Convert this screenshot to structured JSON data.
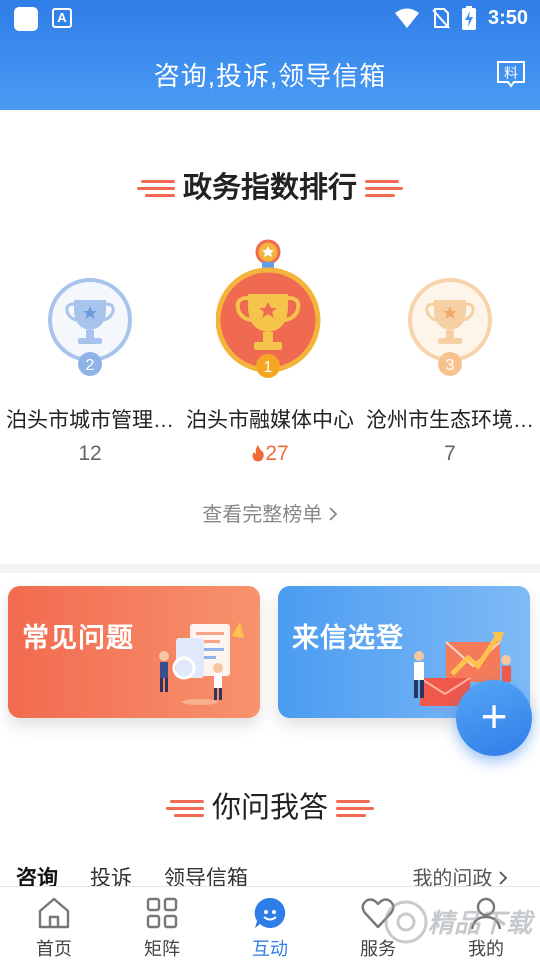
{
  "status_bar": {
    "time": "3:50",
    "notif_icon_letter": "A"
  },
  "header": {
    "title": "咨询,投诉,领导信箱",
    "material_icon_char": "料"
  },
  "ranking": {
    "title": "政务指数排行",
    "items": [
      {
        "rank": "2",
        "name": "泊头市城市管理…",
        "score": "12",
        "hot": false
      },
      {
        "rank": "1",
        "name": "泊头市融媒体中心",
        "score": "27",
        "hot": true
      },
      {
        "rank": "3",
        "name": "沧州市生态环境…",
        "score": "7",
        "hot": false
      }
    ],
    "see_all": "查看完整榜单"
  },
  "cards": {
    "faq_title": "常见问题",
    "letters_title": "来信选登"
  },
  "fab_label": "+",
  "qa": {
    "title": "你问我答",
    "tabs": [
      "咨询",
      "投诉",
      "领导信箱"
    ],
    "my_politics": "我的问政"
  },
  "bottom_nav": [
    {
      "label": "首页",
      "icon": "home-icon",
      "active": false
    },
    {
      "label": "矩阵",
      "icon": "grid-icon",
      "active": false
    },
    {
      "label": "互动",
      "icon": "chat-bubble-icon",
      "active": true
    },
    {
      "label": "服务",
      "icon": "heart-icon",
      "active": false
    },
    {
      "label": "我的",
      "icon": "user-icon",
      "active": false
    }
  ],
  "watermark_text": "精品下载",
  "colors": {
    "primary_blue": "#2f7de6",
    "accent_red": "#f06a52",
    "gold": "#f5b43c",
    "silver": "#8fb3e8",
    "bronze": "#f6c38f"
  }
}
